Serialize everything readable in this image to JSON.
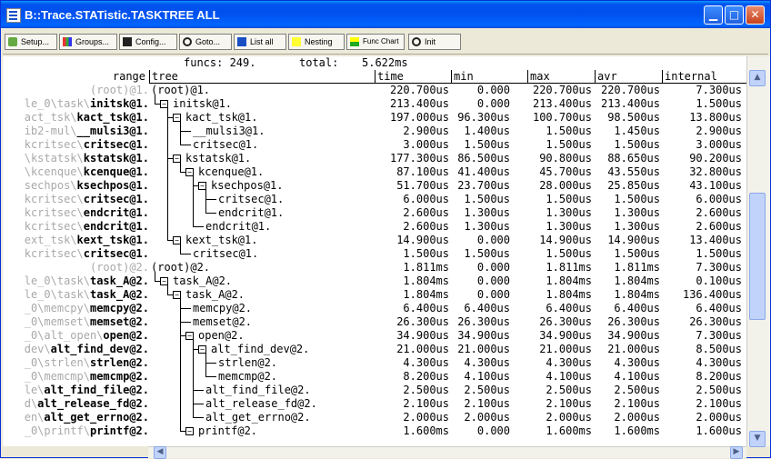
{
  "window": {
    "title": "B::Trace.STATistic.TASKTREE ALL"
  },
  "toolbar": [
    {
      "label": "Setup...",
      "icon": "setup-icon"
    },
    {
      "label": "Groups...",
      "icon": "groups-icon"
    },
    {
      "label": "Config...",
      "icon": "config-icon"
    },
    {
      "label": "Goto...",
      "icon": "goto-icon"
    },
    {
      "label": "List all",
      "icon": "list-icon"
    },
    {
      "label": "Nesting",
      "icon": "nesting-icon"
    },
    {
      "label": "Func Chart",
      "icon": "chart-icon"
    },
    {
      "label": "Init",
      "icon": "init-icon"
    }
  ],
  "summary": {
    "funcs_label": "funcs: 249.",
    "total_label": "total:",
    "total_value": "5.622ms"
  },
  "columns": {
    "range": "range",
    "tree": "tree",
    "time": "time",
    "min": "min",
    "max": "max",
    "avr": "avr",
    "internal": "internal"
  },
  "rows": [
    {
      "range_gray": "(root)@1.",
      "range_bold": "",
      "tree": "(root)@1.",
      "time": "220.700us",
      "min": "0.000",
      "max": "220.700us",
      "avr": "220.700us",
      "internal": "7.300us"
    },
    {
      "range_gray": "le_0\\task\\",
      "range_bold": "initsk@1.",
      "tree": "initsk@1.",
      "time": "213.400us",
      "min": "0.000",
      "max": "213.400us",
      "avr": "213.400us",
      "internal": "1.500us"
    },
    {
      "range_gray": "act_tsk\\",
      "range_bold": "kact_tsk@1.",
      "tree": "kact_tsk@1.",
      "time": "197.000us",
      "min": "96.300us",
      "max": "100.700us",
      "avr": "98.500us",
      "internal": "13.800us"
    },
    {
      "range_gray": "ib2-mul\\",
      "range_bold": "__mulsi3@1.",
      "tree": "__mulsi3@1.",
      "time": "2.900us",
      "min": "1.400us",
      "max": "1.500us",
      "avr": "1.450us",
      "internal": "2.900us"
    },
    {
      "range_gray": "kcritsec\\",
      "range_bold": "critsec@1.",
      "tree": "critsec@1.",
      "time": "3.000us",
      "min": "1.500us",
      "max": "1.500us",
      "avr": "1.500us",
      "internal": "3.000us"
    },
    {
      "range_gray": "\\kstatsk\\",
      "range_bold": "kstatsk@1.",
      "tree": "kstatsk@1.",
      "time": "177.300us",
      "min": "86.500us",
      "max": "90.800us",
      "avr": "88.650us",
      "internal": "90.200us"
    },
    {
      "range_gray": "\\kcenque\\",
      "range_bold": "kcenque@1.",
      "tree": "kcenque@1.",
      "time": "87.100us",
      "min": "41.400us",
      "max": "45.700us",
      "avr": "43.550us",
      "internal": "32.800us"
    },
    {
      "range_gray": "sechpos\\",
      "range_bold": "ksechpos@1.",
      "tree": "ksechpos@1.",
      "time": "51.700us",
      "min": "23.700us",
      "max": "28.000us",
      "avr": "25.850us",
      "internal": "43.100us"
    },
    {
      "range_gray": "kcritsec\\",
      "range_bold": "critsec@1.",
      "tree": "critsec@1.",
      "time": "6.000us",
      "min": "1.500us",
      "max": "1.500us",
      "avr": "1.500us",
      "internal": "6.000us"
    },
    {
      "range_gray": "kcritsec\\",
      "range_bold": "endcrit@1.",
      "tree": "endcrit@1.",
      "time": "2.600us",
      "min": "1.300us",
      "max": "1.300us",
      "avr": "1.300us",
      "internal": "2.600us"
    },
    {
      "range_gray": "kcritsec\\",
      "range_bold": "endcrit@1.",
      "tree": "endcrit@1.",
      "time": "2.600us",
      "min": "1.300us",
      "max": "1.300us",
      "avr": "1.300us",
      "internal": "2.600us"
    },
    {
      "range_gray": "ext_tsk\\",
      "range_bold": "kext_tsk@1.",
      "tree": "kext_tsk@1.",
      "time": "14.900us",
      "min": "0.000",
      "max": "14.900us",
      "avr": "14.900us",
      "internal": "13.400us"
    },
    {
      "range_gray": "kcritsec\\",
      "range_bold": "critsec@1.",
      "tree": "critsec@1.",
      "time": "1.500us",
      "min": "1.500us",
      "max": "1.500us",
      "avr": "1.500us",
      "internal": "1.500us"
    },
    {
      "range_gray": "(root)@2.",
      "range_bold": "",
      "tree": "(root)@2.",
      "time": "1.811ms",
      "min": "0.000",
      "max": "1.811ms",
      "avr": "1.811ms",
      "internal": "7.300us"
    },
    {
      "range_gray": "le_0\\task\\",
      "range_bold": "task_A@2.",
      "tree": "task_A@2.",
      "time": "1.804ms",
      "min": "0.000",
      "max": "1.804ms",
      "avr": "1.804ms",
      "internal": "0.100us"
    },
    {
      "range_gray": "le_0\\task\\",
      "range_bold": "task_A@2.",
      "tree": "task_A@2.",
      "time": "1.804ms",
      "min": "0.000",
      "max": "1.804ms",
      "avr": "1.804ms",
      "internal": "136.400us"
    },
    {
      "range_gray": "_0\\memcpy\\",
      "range_bold": "memcpy@2.",
      "tree": "memcpy@2.",
      "time": "6.400us",
      "min": "6.400us",
      "max": "6.400us",
      "avr": "6.400us",
      "internal": "6.400us"
    },
    {
      "range_gray": "_0\\memset\\",
      "range_bold": "memset@2.",
      "tree": "memset@2.",
      "time": "26.300us",
      "min": "26.300us",
      "max": "26.300us",
      "avr": "26.300us",
      "internal": "26.300us"
    },
    {
      "range_gray": "_0\\alt_open\\",
      "range_bold": "open@2.",
      "tree": "open@2.",
      "time": "34.900us",
      "min": "34.900us",
      "max": "34.900us",
      "avr": "34.900us",
      "internal": "7.300us"
    },
    {
      "range_gray": "dev\\",
      "range_bold": "alt_find_dev@2.",
      "tree": "alt_find_dev@2.",
      "time": "21.000us",
      "min": "21.000us",
      "max": "21.000us",
      "avr": "21.000us",
      "internal": "8.500us"
    },
    {
      "range_gray": "_0\\strlen\\",
      "range_bold": "strlen@2.",
      "tree": "strlen@2.",
      "time": "4.300us",
      "min": "4.300us",
      "max": "4.300us",
      "avr": "4.300us",
      "internal": "4.300us"
    },
    {
      "range_gray": "_0\\memcmp\\",
      "range_bold": "memcmp@2.",
      "tree": "memcmp@2.",
      "time": "8.200us",
      "min": "4.100us",
      "max": "4.100us",
      "avr": "4.100us",
      "internal": "8.200us"
    },
    {
      "range_gray": "le\\",
      "range_bold": "alt_find_file@2.",
      "tree": "alt_find_file@2.",
      "time": "2.500us",
      "min": "2.500us",
      "max": "2.500us",
      "avr": "2.500us",
      "internal": "2.500us"
    },
    {
      "range_gray": "d\\",
      "range_bold": "alt_release_fd@2.",
      "tree": "alt_release_fd@2.",
      "time": "2.100us",
      "min": "2.100us",
      "max": "2.100us",
      "avr": "2.100us",
      "internal": "2.100us"
    },
    {
      "range_gray": "en\\",
      "range_bold": "alt_get_errno@2.",
      "tree": "alt_get_errno@2.",
      "time": "2.000us",
      "min": "2.000us",
      "max": "2.000us",
      "avr": "2.000us",
      "internal": "2.000us"
    },
    {
      "range_gray": "_0\\printf\\",
      "range_bold": "printf@2.",
      "tree": "printf@2.",
      "time": "1.600ms",
      "min": "0.000",
      "max": "1.600ms",
      "avr": "1.600ms",
      "internal": "1.600us"
    }
  ]
}
